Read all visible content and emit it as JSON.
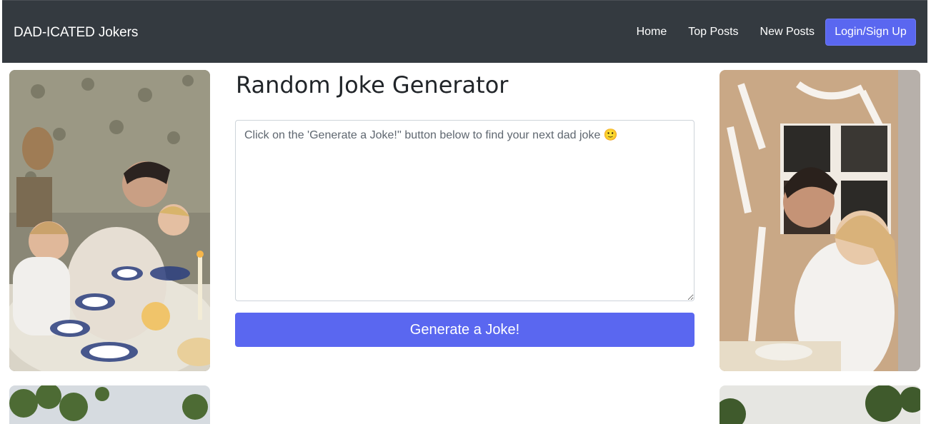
{
  "navbar": {
    "brand": "DAD-ICATED Jokers",
    "links": [
      "Home",
      "Top Posts",
      "New Posts"
    ],
    "login_label": "Login/Sign Up"
  },
  "main": {
    "title": "Random Joke Generator",
    "joke_text": "Click on the 'Generate a Joke!'' button below to find your next dad joke 🙂",
    "generate_label": "Generate a Joke!"
  },
  "images": {
    "left_top": "family-breakfast-photo",
    "right_top": "cardboard-house-photo",
    "left_bottom": "trees-photo",
    "right_bottom": "trees-photo"
  },
  "colors": {
    "navbar_bg": "#343a40",
    "accent": "#5a67f0"
  }
}
